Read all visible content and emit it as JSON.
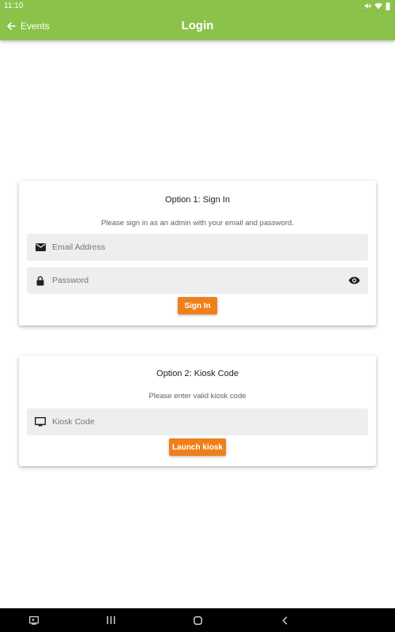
{
  "status_bar": {
    "time": "11:10",
    "icons": [
      "mute-icon",
      "wifi-icon",
      "battery-icon"
    ]
  },
  "app_bar": {
    "back_label": "Events",
    "title": "Login",
    "color": "#8bc34a"
  },
  "sign_in_card": {
    "title": "Option 1: Sign In",
    "subtitle": "Please sign in as an admin with your email and password.",
    "email": {
      "placeholder": "Email Address",
      "value": "",
      "icon": "mail-icon"
    },
    "password": {
      "placeholder": "Password",
      "value": "",
      "icon": "lock-icon",
      "toggle_icon": "eye-icon"
    },
    "button_label": "Sign In"
  },
  "kiosk_card": {
    "title": "Option 2: Kiosk Code",
    "subtitle": "Please enter valid kiosk code",
    "kiosk_code": {
      "placeholder": "Kiosk Code",
      "value": "",
      "icon": "monitor-icon"
    },
    "button_label": "Launch kiosk"
  },
  "accent_color": "#ef7f1a",
  "nav_bar": {
    "items": [
      "screenshot-icon",
      "recent-apps-icon",
      "home-icon",
      "back-icon"
    ]
  }
}
